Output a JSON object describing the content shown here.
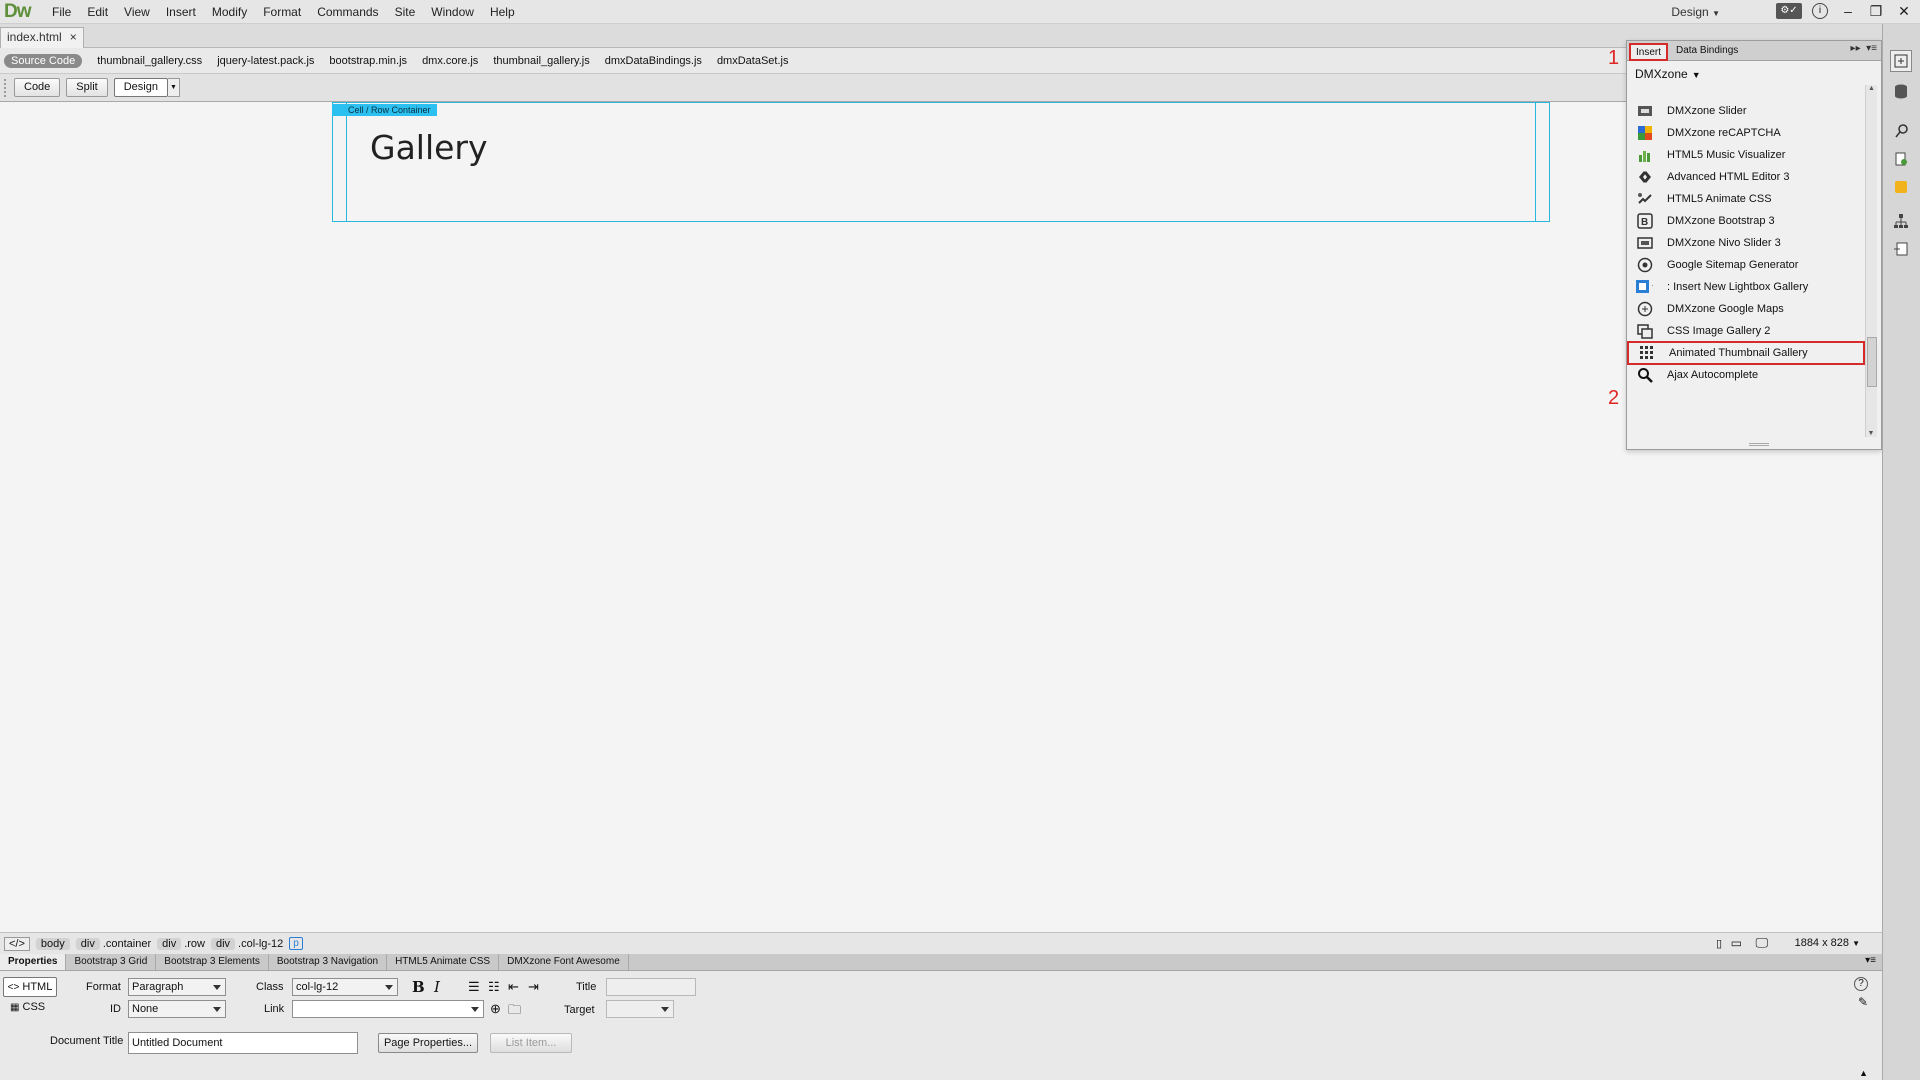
{
  "app": {
    "logo": "Dw",
    "menus": [
      "File",
      "Edit",
      "View",
      "Insert",
      "Modify",
      "Format",
      "Commands",
      "Site",
      "Window",
      "Help"
    ],
    "workspace": "Design"
  },
  "document": {
    "tab_label": "index.html",
    "close_glyph": "×"
  },
  "related_files": {
    "source_code": "Source Code",
    "files": [
      "thumbnail_gallery.css",
      "jquery-latest.pack.js",
      "bootstrap.min.js",
      "dmx.core.js",
      "thumbnail_gallery.js",
      "dmxDataBindings.js",
      "dmxDataSet.js"
    ]
  },
  "view_buttons": {
    "code": "Code",
    "split": "Split",
    "design": "Design"
  },
  "canvas": {
    "cell_tag": "Cell  / Row Container",
    "heading": "Gallery"
  },
  "insert_panel": {
    "tabs": {
      "insert": "Insert",
      "data_bindings": "Data Bindings"
    },
    "category": "DMXzone",
    "items": [
      {
        "label": "DMXzone Slider",
        "icon": "slider-icon"
      },
      {
        "label": "DMXzone reCAPTCHA",
        "icon": "recaptcha-icon"
      },
      {
        "label": "HTML5 Music Visualizer",
        "icon": "music-visualizer-icon"
      },
      {
        "label": "Advanced HTML Editor 3",
        "icon": "html-editor-icon"
      },
      {
        "label": "HTML5 Animate CSS",
        "icon": "animate-css-icon"
      },
      {
        "label": "DMXzone Bootstrap 3",
        "icon": "bootstrap-icon"
      },
      {
        "label": "DMXzone Nivo Slider 3",
        "icon": "nivo-slider-icon"
      },
      {
        "label": "Google Sitemap Generator",
        "icon": "sitemap-icon"
      },
      {
        "label": ": Insert New Lightbox Gallery",
        "icon": "lightbox-icon"
      },
      {
        "label": "DMXzone Google Maps",
        "icon": "google-maps-icon"
      },
      {
        "label": "CSS Image Gallery 2",
        "icon": "image-gallery-icon"
      },
      {
        "label": "Animated Thumbnail Gallery",
        "icon": "thumbnail-grid-icon"
      },
      {
        "label": "Ajax Autocomplete",
        "icon": "magnifier-icon"
      }
    ],
    "annotations": {
      "first": "1",
      "second": "2"
    }
  },
  "status_bar": {
    "tag_selector": "</>",
    "crumbs": [
      {
        "tag": "body",
        "cls": ""
      },
      {
        "tag": "div",
        "cls": ".container"
      },
      {
        "tag": "div",
        "cls": ".row"
      },
      {
        "tag": "div",
        "cls": ".col-lg-12"
      }
    ],
    "current": "p",
    "dimensions": "1884 x 828"
  },
  "properties": {
    "tabs": [
      "Properties",
      "Bootstrap 3 Grid",
      "Bootstrap 3 Elements",
      "Bootstrap 3 Navigation",
      "HTML5 Animate CSS",
      "DMXzone Font Awesome"
    ],
    "html_button": "HTML",
    "css_button": "CSS",
    "format_label": "Format",
    "format_value": "Paragraph",
    "id_label": "ID",
    "id_value": "None",
    "class_label": "Class",
    "class_value": "col-lg-12",
    "link_label": "Link",
    "link_value": "",
    "title_label": "Title",
    "title_value": "",
    "target_label": "Target",
    "target_value": "",
    "doc_title_label": "Document Title",
    "doc_title_value": "Untitled Document",
    "page_properties": "Page Properties...",
    "list_item": "List Item..."
  }
}
